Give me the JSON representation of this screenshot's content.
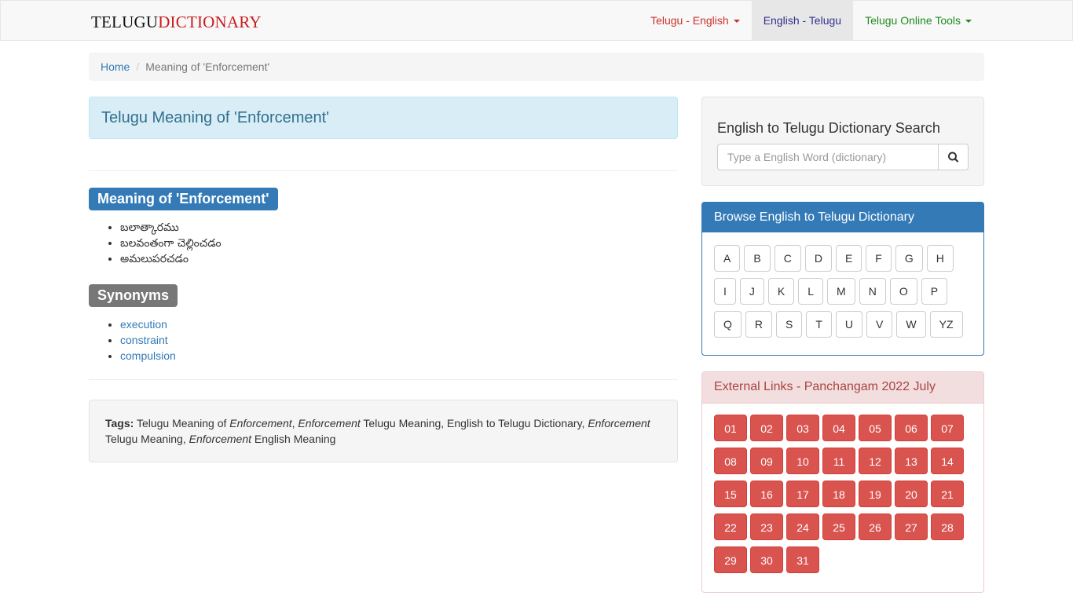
{
  "navbar": {
    "brand_part1": "TELUGU",
    "brand_part2": "DICTIONARY",
    "menu_telugu_english": "Telugu - English",
    "menu_english_telugu": "English - Telugu",
    "menu_online_tools": "Telugu Online Tools"
  },
  "breadcrumb": {
    "home": "Home",
    "separator": "/",
    "current": "Meaning of 'Enforcement'"
  },
  "main": {
    "heading": "Telugu Meaning of 'Enforcement'",
    "meaning_label": "Meaning of 'Enforcement'",
    "meanings": [
      "బలాత్కారము",
      "బలవంతంగా చెల్లించడం",
      "అమలుపరచడం"
    ],
    "synonyms_label": "Synonyms",
    "synonyms": [
      "execution",
      "constraint",
      "compulsion"
    ],
    "tags": {
      "label": "Tags:",
      "t1": "Telugu Meaning of ",
      "w1": "Enforcement",
      "t2": ", ",
      "w2": "Enforcement",
      "t3": " Telugu Meaning, English to Telugu Dictionary, ",
      "w3": "Enforcement",
      "t4": " Telugu Meaning, ",
      "w4": "Enforcement",
      "t5": " English Meaning"
    }
  },
  "search": {
    "title": "English to Telugu Dictionary Search",
    "placeholder": "Type a English Word (dictionary)",
    "button_icon": "search-icon"
  },
  "browse": {
    "title": "Browse English to Telugu Dictionary",
    "letters": [
      [
        "A",
        "B",
        "C",
        "D",
        "E",
        "F",
        "G",
        "H"
      ],
      [
        "I",
        "J",
        "K",
        "L",
        "M",
        "N",
        "O",
        "P"
      ],
      [
        "Q",
        "R",
        "S",
        "T",
        "U",
        "V",
        "W",
        "YZ"
      ]
    ]
  },
  "external": {
    "title": "External Links - Panchangam 2022 July",
    "days": [
      "01",
      "02",
      "03",
      "04",
      "05",
      "06",
      "07",
      "08",
      "09",
      "10",
      "11",
      "12",
      "13",
      "14",
      "15",
      "16",
      "17",
      "18",
      "19",
      "20",
      "21",
      "22",
      "23",
      "24",
      "25",
      "26",
      "27",
      "28",
      "29",
      "30",
      "31"
    ]
  },
  "colors": {
    "primary": "#337ab7",
    "danger": "#d9534f",
    "info_bg": "#d9edf7",
    "brand_red": "#c81c1c"
  }
}
